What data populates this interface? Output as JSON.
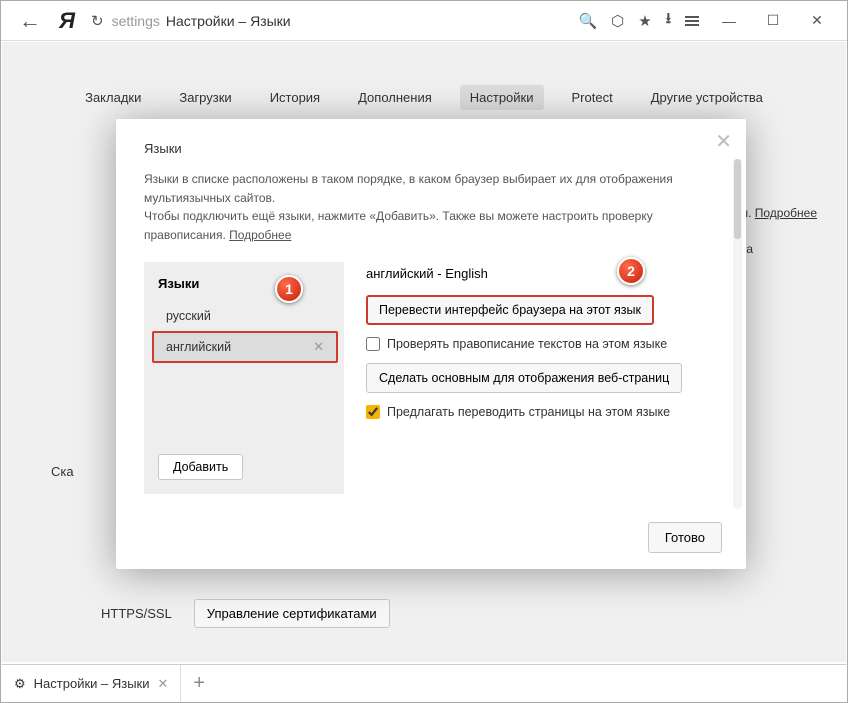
{
  "titlebar": {
    "url_prefix": "settings",
    "url_title": "Настройки – Языки"
  },
  "nav_tabs": {
    "bookmarks": "Закладки",
    "downloads": "Загрузки",
    "history": "История",
    "addons": "Дополнения",
    "settings": "Настройки",
    "protect": "Protect",
    "devices": "Другие устройства"
  },
  "bg": {
    "right_text_suffix": "темы.",
    "right_text_link": "Подробнее",
    "char_a": "а",
    "ska": "Ска",
    "https_label": "HTTPS/SSL",
    "cert_button": "Управление сертификатами"
  },
  "modal": {
    "title": "Языки",
    "desc_line1": "Языки в списке расположены в таком порядке, в каком браузер выбирает их для отображения мультиязычных сайтов.",
    "desc_line2a": "Чтобы подключить ещё языки, нажмите «Добавить». Также вы можете настроить проверку правописания.",
    "desc_link": "Подробнее",
    "list_header": "Языки",
    "items": {
      "ru": "русский",
      "en": "английский"
    },
    "add_btn": "Добавить",
    "detail": {
      "header": "английский - English",
      "translate_ui": "Перевести интерфейс браузера на этот язык",
      "spellcheck": "Проверять правописание текстов на этом языке",
      "make_default": "Сделать основным для отображения веб-страниц",
      "offer_translate": "Предлагать переводить страницы на этом языке"
    },
    "done": "Готово"
  },
  "tabbar": {
    "title": "Настройки – Языки"
  },
  "badges": {
    "b1": "1",
    "b2": "2"
  }
}
